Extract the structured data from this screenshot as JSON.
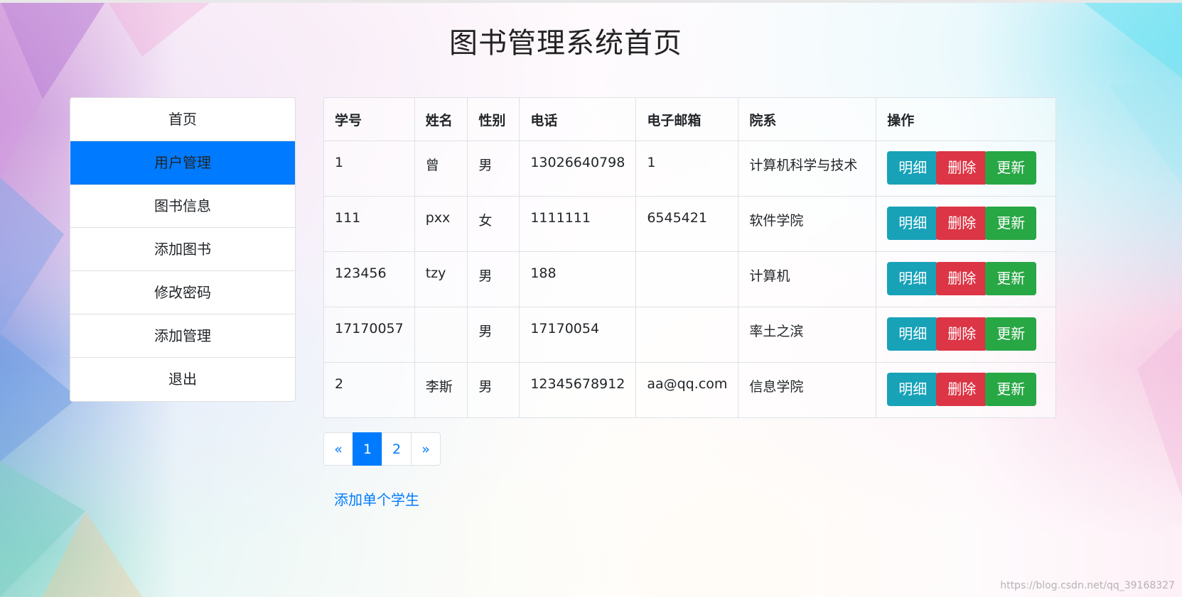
{
  "page": {
    "title": "图书管理系统首页"
  },
  "sidebar": {
    "items": [
      {
        "label": "首页",
        "active": false
      },
      {
        "label": "用户管理",
        "active": true
      },
      {
        "label": "图书信息",
        "active": false
      },
      {
        "label": "添加图书",
        "active": false
      },
      {
        "label": "修改密码",
        "active": false
      },
      {
        "label": "添加管理",
        "active": false
      },
      {
        "label": "退出",
        "active": false
      }
    ]
  },
  "table": {
    "headers": [
      "学号",
      "姓名",
      "性别",
      "电话",
      "电子邮箱",
      "院系",
      "操作"
    ],
    "rows": [
      {
        "id": "1",
        "name": "曾",
        "gender": "男",
        "phone": "13026640798",
        "email": "1",
        "dept": "计算机科学与技术"
      },
      {
        "id": "111",
        "name": "pxx",
        "gender": "女",
        "phone": "1111111",
        "email": "6545421",
        "dept": "软件学院"
      },
      {
        "id": "123456",
        "name": "tzy",
        "gender": "男",
        "phone": "188",
        "email": "",
        "dept": "计算机"
      },
      {
        "id": "17170057",
        "name": "",
        "gender": "男",
        "phone": "17170054",
        "email": "",
        "dept": "率土之滨"
      },
      {
        "id": "2",
        "name": "李斯",
        "gender": "男",
        "phone": "12345678912",
        "email": "aa@qq.com",
        "dept": "信息学院"
      }
    ],
    "actions": {
      "detail": "明细",
      "delete": "删除",
      "update": "更新"
    }
  },
  "pagination": {
    "prev": "«",
    "pages": [
      "1",
      "2"
    ],
    "current": "1",
    "next": "»"
  },
  "add_student_link": "添加单个学生",
  "watermark": "https://blog.csdn.net/qq_39168327",
  "colors": {
    "primary": "#007bff",
    "info": "#17a2b8",
    "danger": "#dc3545",
    "success": "#28a745"
  }
}
